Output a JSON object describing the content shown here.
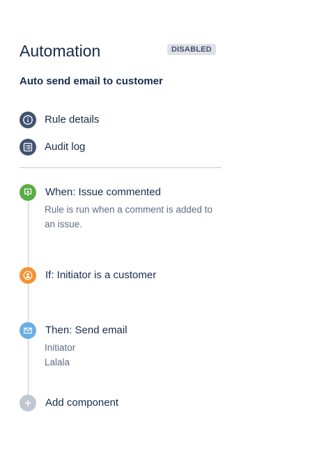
{
  "header": {
    "title": "Automation",
    "status_badge": "DISABLED"
  },
  "rule": {
    "name": "Auto send email to customer"
  },
  "nav": {
    "items": [
      {
        "label": "Rule details",
        "icon": "info-icon"
      },
      {
        "label": "Audit log",
        "icon": "list-icon"
      }
    ]
  },
  "steps": {
    "trigger": {
      "title": "When: Issue commented",
      "description_lines": [
        "Rule is run when a comment is added to",
        "an issue."
      ],
      "icon": "comment-trigger-icon",
      "color": "#5aac44"
    },
    "condition": {
      "title": "If: Initiator is a customer",
      "icon": "user-condition-icon",
      "color": "#f79232"
    },
    "action": {
      "title": "Then: Send email",
      "details": [
        "Initiator",
        "Lalala"
      ],
      "icon": "email-action-icon",
      "color": "#6aaee2"
    },
    "add": {
      "title": "Add component",
      "icon": "plus-icon",
      "color": "#c1c7d0"
    }
  }
}
